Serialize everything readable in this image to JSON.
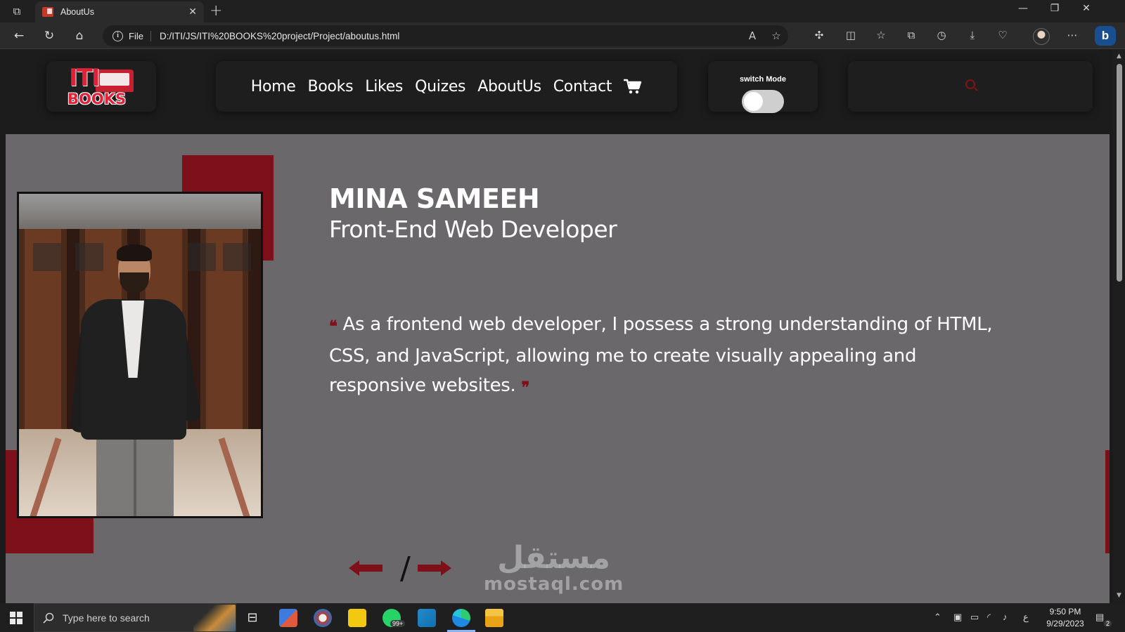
{
  "browser": {
    "tab_title": "AboutUs",
    "tab_close": "✕",
    "new_tab": "+",
    "file_label": "File",
    "url": "D:/ITI/JS/ITI%20BOOKS%20project/Project/aboutus.html",
    "window_controls": [
      "—",
      "❐",
      "✕"
    ]
  },
  "header": {
    "logo_text_top": "ITI",
    "logo_text_bottom": "BOOKS",
    "nav": [
      "Home",
      "Books",
      "Likes",
      "Quizes",
      "AboutUs",
      "Contact"
    ],
    "mode_label": "switch Mode",
    "mode_on": false
  },
  "about": {
    "name": "MINA SAMEEH",
    "role": "Front-End Web Developer",
    "quote_open": "❝",
    "quote": "As a frontend web developer, I possess a strong understanding of HTML, CSS, and JavaScript, allowing me to create visually appealing and responsive websites.",
    "quote_close": "❞",
    "slash": "/"
  },
  "watermark": {
    "arabic": "مستقل",
    "latin": "mostaql.com"
  },
  "taskbar": {
    "search_placeholder": "Type here to search",
    "whatsapp_badge": "99+",
    "lang": "ع",
    "time": "9:50 PM",
    "date": "9/29/2023",
    "notifications": "2"
  },
  "colors": {
    "accent": "#7d1018",
    "content_bg": "#6a686b",
    "header_bg": "#1c1c1c"
  }
}
